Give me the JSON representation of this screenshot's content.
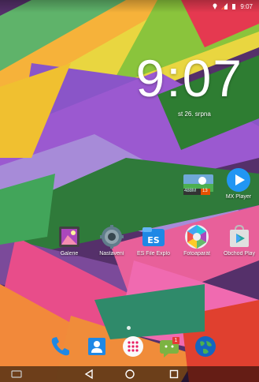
{
  "status_bar": {
    "time": "9:07",
    "icons": [
      "location-icon",
      "signal-icon",
      "battery-icon"
    ]
  },
  "lock_clock": {
    "time": "9:07",
    "date": "st 26. srpna"
  },
  "widget": {
    "text": "488M",
    "badge": "13"
  },
  "apps": [
    {
      "label": "MX Player",
      "icon": "mx-player-icon"
    },
    {
      "label": "Galerie",
      "icon": "gallery-icon"
    },
    {
      "label": "Nastavení",
      "icon": "settings-gear-icon"
    },
    {
      "label": "ES File Explo",
      "icon": "es-file-explorer-icon"
    },
    {
      "label": "Fotoaparát",
      "icon": "camera-aperture-icon"
    },
    {
      "label": "Obchod Play",
      "icon": "play-store-icon"
    }
  ],
  "dock": {
    "items": [
      "phone-icon",
      "contacts-icon",
      "app-drawer-icon",
      "messaging-icon",
      "browser-globe-icon"
    ],
    "messaging_badge": "1"
  },
  "nav_bar": {
    "buttons": [
      "back-icon",
      "home-icon",
      "recents-icon"
    ]
  },
  "colors": {
    "accent_blue": "#2196F3",
    "clock_white": "#FFFFFF"
  }
}
